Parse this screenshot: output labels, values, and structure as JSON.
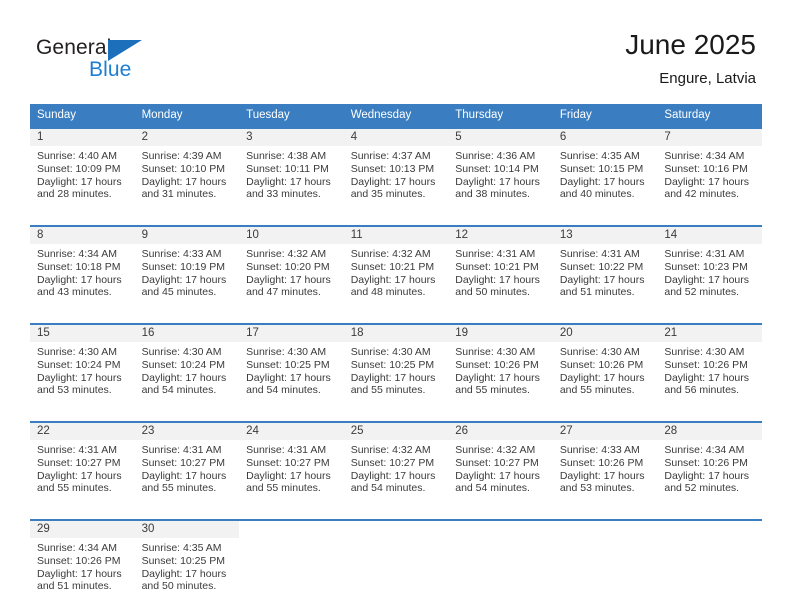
{
  "brand": {
    "name_part1": "General",
    "name_part2": "Blue",
    "color_dark": "#231f20",
    "color_blue": "#1c7ed0"
  },
  "header": {
    "title": "June 2025",
    "subtitle": "Engure, Latvia",
    "accent_color": "#3a7dc0"
  },
  "calendar": {
    "weekday_headers": [
      "Sunday",
      "Monday",
      "Tuesday",
      "Wednesday",
      "Thursday",
      "Friday",
      "Saturday"
    ],
    "weeks": [
      [
        {
          "day": "1",
          "info": "Sunrise: 4:40 AM\nSunset: 10:09 PM\nDaylight: 17 hours and 28 minutes."
        },
        {
          "day": "2",
          "info": "Sunrise: 4:39 AM\nSunset: 10:10 PM\nDaylight: 17 hours and 31 minutes."
        },
        {
          "day": "3",
          "info": "Sunrise: 4:38 AM\nSunset: 10:11 PM\nDaylight: 17 hours and 33 minutes."
        },
        {
          "day": "4",
          "info": "Sunrise: 4:37 AM\nSunset: 10:13 PM\nDaylight: 17 hours and 35 minutes."
        },
        {
          "day": "5",
          "info": "Sunrise: 4:36 AM\nSunset: 10:14 PM\nDaylight: 17 hours and 38 minutes."
        },
        {
          "day": "6",
          "info": "Sunrise: 4:35 AM\nSunset: 10:15 PM\nDaylight: 17 hours and 40 minutes."
        },
        {
          "day": "7",
          "info": "Sunrise: 4:34 AM\nSunset: 10:16 PM\nDaylight: 17 hours and 42 minutes."
        }
      ],
      [
        {
          "day": "8",
          "info": "Sunrise: 4:34 AM\nSunset: 10:18 PM\nDaylight: 17 hours and 43 minutes."
        },
        {
          "day": "9",
          "info": "Sunrise: 4:33 AM\nSunset: 10:19 PM\nDaylight: 17 hours and 45 minutes."
        },
        {
          "day": "10",
          "info": "Sunrise: 4:32 AM\nSunset: 10:20 PM\nDaylight: 17 hours and 47 minutes."
        },
        {
          "day": "11",
          "info": "Sunrise: 4:32 AM\nSunset: 10:21 PM\nDaylight: 17 hours and 48 minutes."
        },
        {
          "day": "12",
          "info": "Sunrise: 4:31 AM\nSunset: 10:21 PM\nDaylight: 17 hours and 50 minutes."
        },
        {
          "day": "13",
          "info": "Sunrise: 4:31 AM\nSunset: 10:22 PM\nDaylight: 17 hours and 51 minutes."
        },
        {
          "day": "14",
          "info": "Sunrise: 4:31 AM\nSunset: 10:23 PM\nDaylight: 17 hours and 52 minutes."
        }
      ],
      [
        {
          "day": "15",
          "info": "Sunrise: 4:30 AM\nSunset: 10:24 PM\nDaylight: 17 hours and 53 minutes."
        },
        {
          "day": "16",
          "info": "Sunrise: 4:30 AM\nSunset: 10:24 PM\nDaylight: 17 hours and 54 minutes."
        },
        {
          "day": "17",
          "info": "Sunrise: 4:30 AM\nSunset: 10:25 PM\nDaylight: 17 hours and 54 minutes."
        },
        {
          "day": "18",
          "info": "Sunrise: 4:30 AM\nSunset: 10:25 PM\nDaylight: 17 hours and 55 minutes."
        },
        {
          "day": "19",
          "info": "Sunrise: 4:30 AM\nSunset: 10:26 PM\nDaylight: 17 hours and 55 minutes."
        },
        {
          "day": "20",
          "info": "Sunrise: 4:30 AM\nSunset: 10:26 PM\nDaylight: 17 hours and 55 minutes."
        },
        {
          "day": "21",
          "info": "Sunrise: 4:30 AM\nSunset: 10:26 PM\nDaylight: 17 hours and 56 minutes."
        }
      ],
      [
        {
          "day": "22",
          "info": "Sunrise: 4:31 AM\nSunset: 10:27 PM\nDaylight: 17 hours and 55 minutes."
        },
        {
          "day": "23",
          "info": "Sunrise: 4:31 AM\nSunset: 10:27 PM\nDaylight: 17 hours and 55 minutes."
        },
        {
          "day": "24",
          "info": "Sunrise: 4:31 AM\nSunset: 10:27 PM\nDaylight: 17 hours and 55 minutes."
        },
        {
          "day": "25",
          "info": "Sunrise: 4:32 AM\nSunset: 10:27 PM\nDaylight: 17 hours and 54 minutes."
        },
        {
          "day": "26",
          "info": "Sunrise: 4:32 AM\nSunset: 10:27 PM\nDaylight: 17 hours and 54 minutes."
        },
        {
          "day": "27",
          "info": "Sunrise: 4:33 AM\nSunset: 10:26 PM\nDaylight: 17 hours and 53 minutes."
        },
        {
          "day": "28",
          "info": "Sunrise: 4:34 AM\nSunset: 10:26 PM\nDaylight: 17 hours and 52 minutes."
        }
      ],
      [
        {
          "day": "29",
          "info": "Sunrise: 4:34 AM\nSunset: 10:26 PM\nDaylight: 17 hours and 51 minutes."
        },
        {
          "day": "30",
          "info": "Sunrise: 4:35 AM\nSunset: 10:25 PM\nDaylight: 17 hours and 50 minutes."
        },
        {
          "day": "",
          "info": ""
        },
        {
          "day": "",
          "info": ""
        },
        {
          "day": "",
          "info": ""
        },
        {
          "day": "",
          "info": ""
        },
        {
          "day": "",
          "info": ""
        }
      ]
    ]
  }
}
